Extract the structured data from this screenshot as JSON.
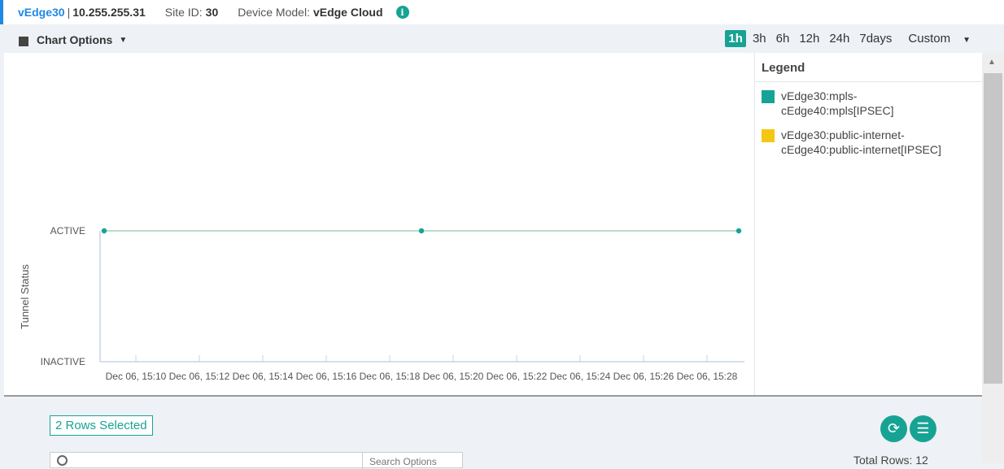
{
  "header": {
    "device_name": "vEdge30",
    "separator": "|",
    "ip": "10.255.255.31",
    "site_label": "Site ID:",
    "site_id": "30",
    "model_label": "Device Model:",
    "model": "vEdge Cloud",
    "info_icon": "info-icon"
  },
  "toolbar": {
    "chart_options_label": "Chart Options",
    "time_ranges": [
      "1h",
      "3h",
      "6h",
      "12h",
      "24h",
      "7days"
    ],
    "selected_range": "1h",
    "custom_label": "Custom"
  },
  "legend": {
    "title": "Legend",
    "items": [
      {
        "label_line1": "vEdge30:mpls-",
        "label_line2": "cEdge40:mpls[IPSEC]",
        "color": "#17a394"
      },
      {
        "label_line1": "vEdge30:public-internet-",
        "label_line2": "cEdge40:public-internet[IPSEC]",
        "color": "#f2c811"
      }
    ]
  },
  "chart_data": {
    "type": "line",
    "ylabel": "Tunnel Status",
    "y_categories": [
      "INACTIVE",
      "ACTIVE"
    ],
    "x_ticks": [
      "Dec 06, 15:10",
      "Dec 06, 15:12",
      "Dec 06, 15:14",
      "Dec 06, 15:16",
      "Dec 06, 15:18",
      "Dec 06, 15:20",
      "Dec 06, 15:22",
      "Dec 06, 15:24",
      "Dec 06, 15:26",
      "Dec 06, 15:28"
    ],
    "xlim": [
      "Dec 06, 15:09",
      "Dec 06, 15:29"
    ],
    "series": [
      {
        "name": "vEdge30:mpls-cEdge40:mpls[IPSEC]",
        "color": "#17a394",
        "points": [
          [
            "Dec 06, 15:09",
            "ACTIVE"
          ],
          [
            "Dec 06, 15:19",
            "ACTIVE"
          ],
          [
            "Dec 06, 15:29",
            "ACTIVE"
          ]
        ]
      },
      {
        "name": "vEdge30:public-internet-cEdge40:public-internet[IPSEC]",
        "color": "#f2c811",
        "points": [
          [
            "Dec 06, 15:09",
            "ACTIVE"
          ],
          [
            "Dec 06, 15:19",
            "ACTIVE"
          ],
          [
            "Dec 06, 15:29",
            "ACTIVE"
          ]
        ]
      }
    ]
  },
  "bottom": {
    "rows_selected": "2 Rows Selected",
    "search_options": "Search Options",
    "total_rows": "Total Rows: 12"
  }
}
